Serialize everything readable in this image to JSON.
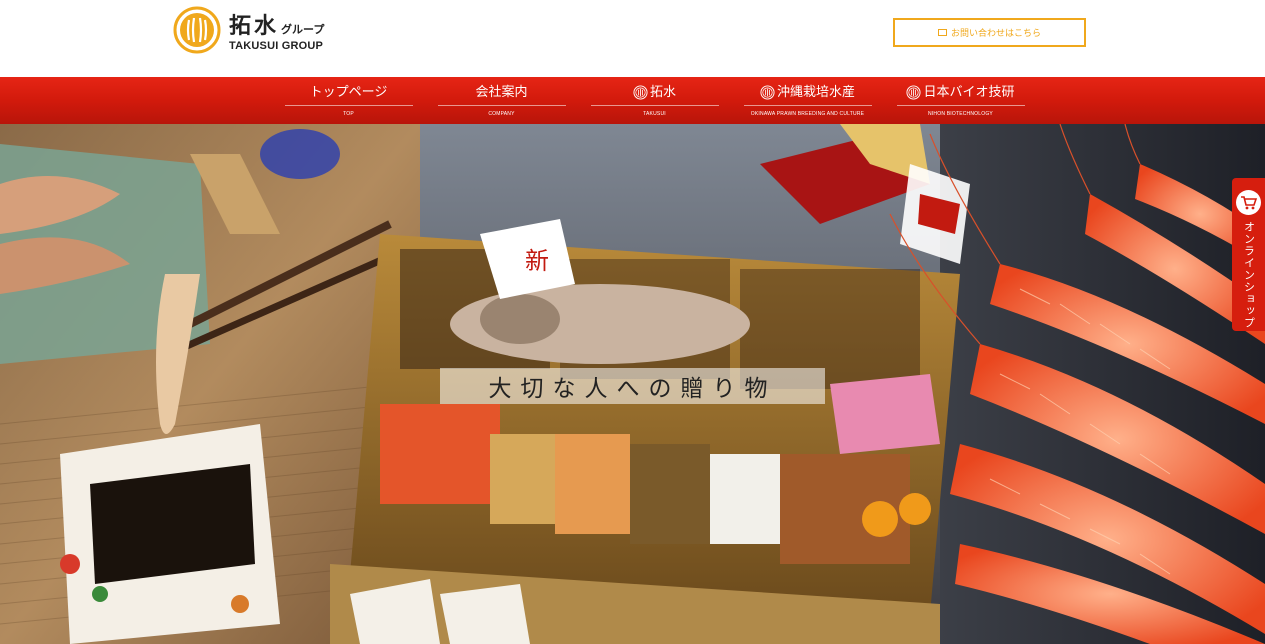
{
  "header": {
    "logo_jp_big": "拓水",
    "logo_jp_small": "グループ",
    "logo_en": "TAKUSUI GROUP",
    "contact_label": "お問い合わせはこちら"
  },
  "nav": {
    "items": [
      {
        "label": "トップページ",
        "sub": "TOP",
        "icon": ""
      },
      {
        "label": "会社案内",
        "sub": "COMPANY",
        "icon": ""
      },
      {
        "label": "拓水",
        "sub": "TAKUSUI",
        "icon": "takusui-logo-icon"
      },
      {
        "label": "沖縄栽培水産",
        "sub": "OKINAWA PRAWN BREEDING AND CULTURE",
        "icon": "takusui-logo-icon"
      },
      {
        "label": "日本バイオ技研",
        "sub": "NIHON BIOTECHNOLOGY",
        "icon": "takusui-logo-icon"
      }
    ]
  },
  "hero": {
    "caption": "大切な人への贈り物"
  },
  "side_tab": {
    "label": "オンラインショップ",
    "icon": "cart-icon"
  },
  "colors": {
    "nav_red": "#d21a0c",
    "accent_orange": "#f0a81c",
    "logo_orange": "#f0a81c"
  }
}
